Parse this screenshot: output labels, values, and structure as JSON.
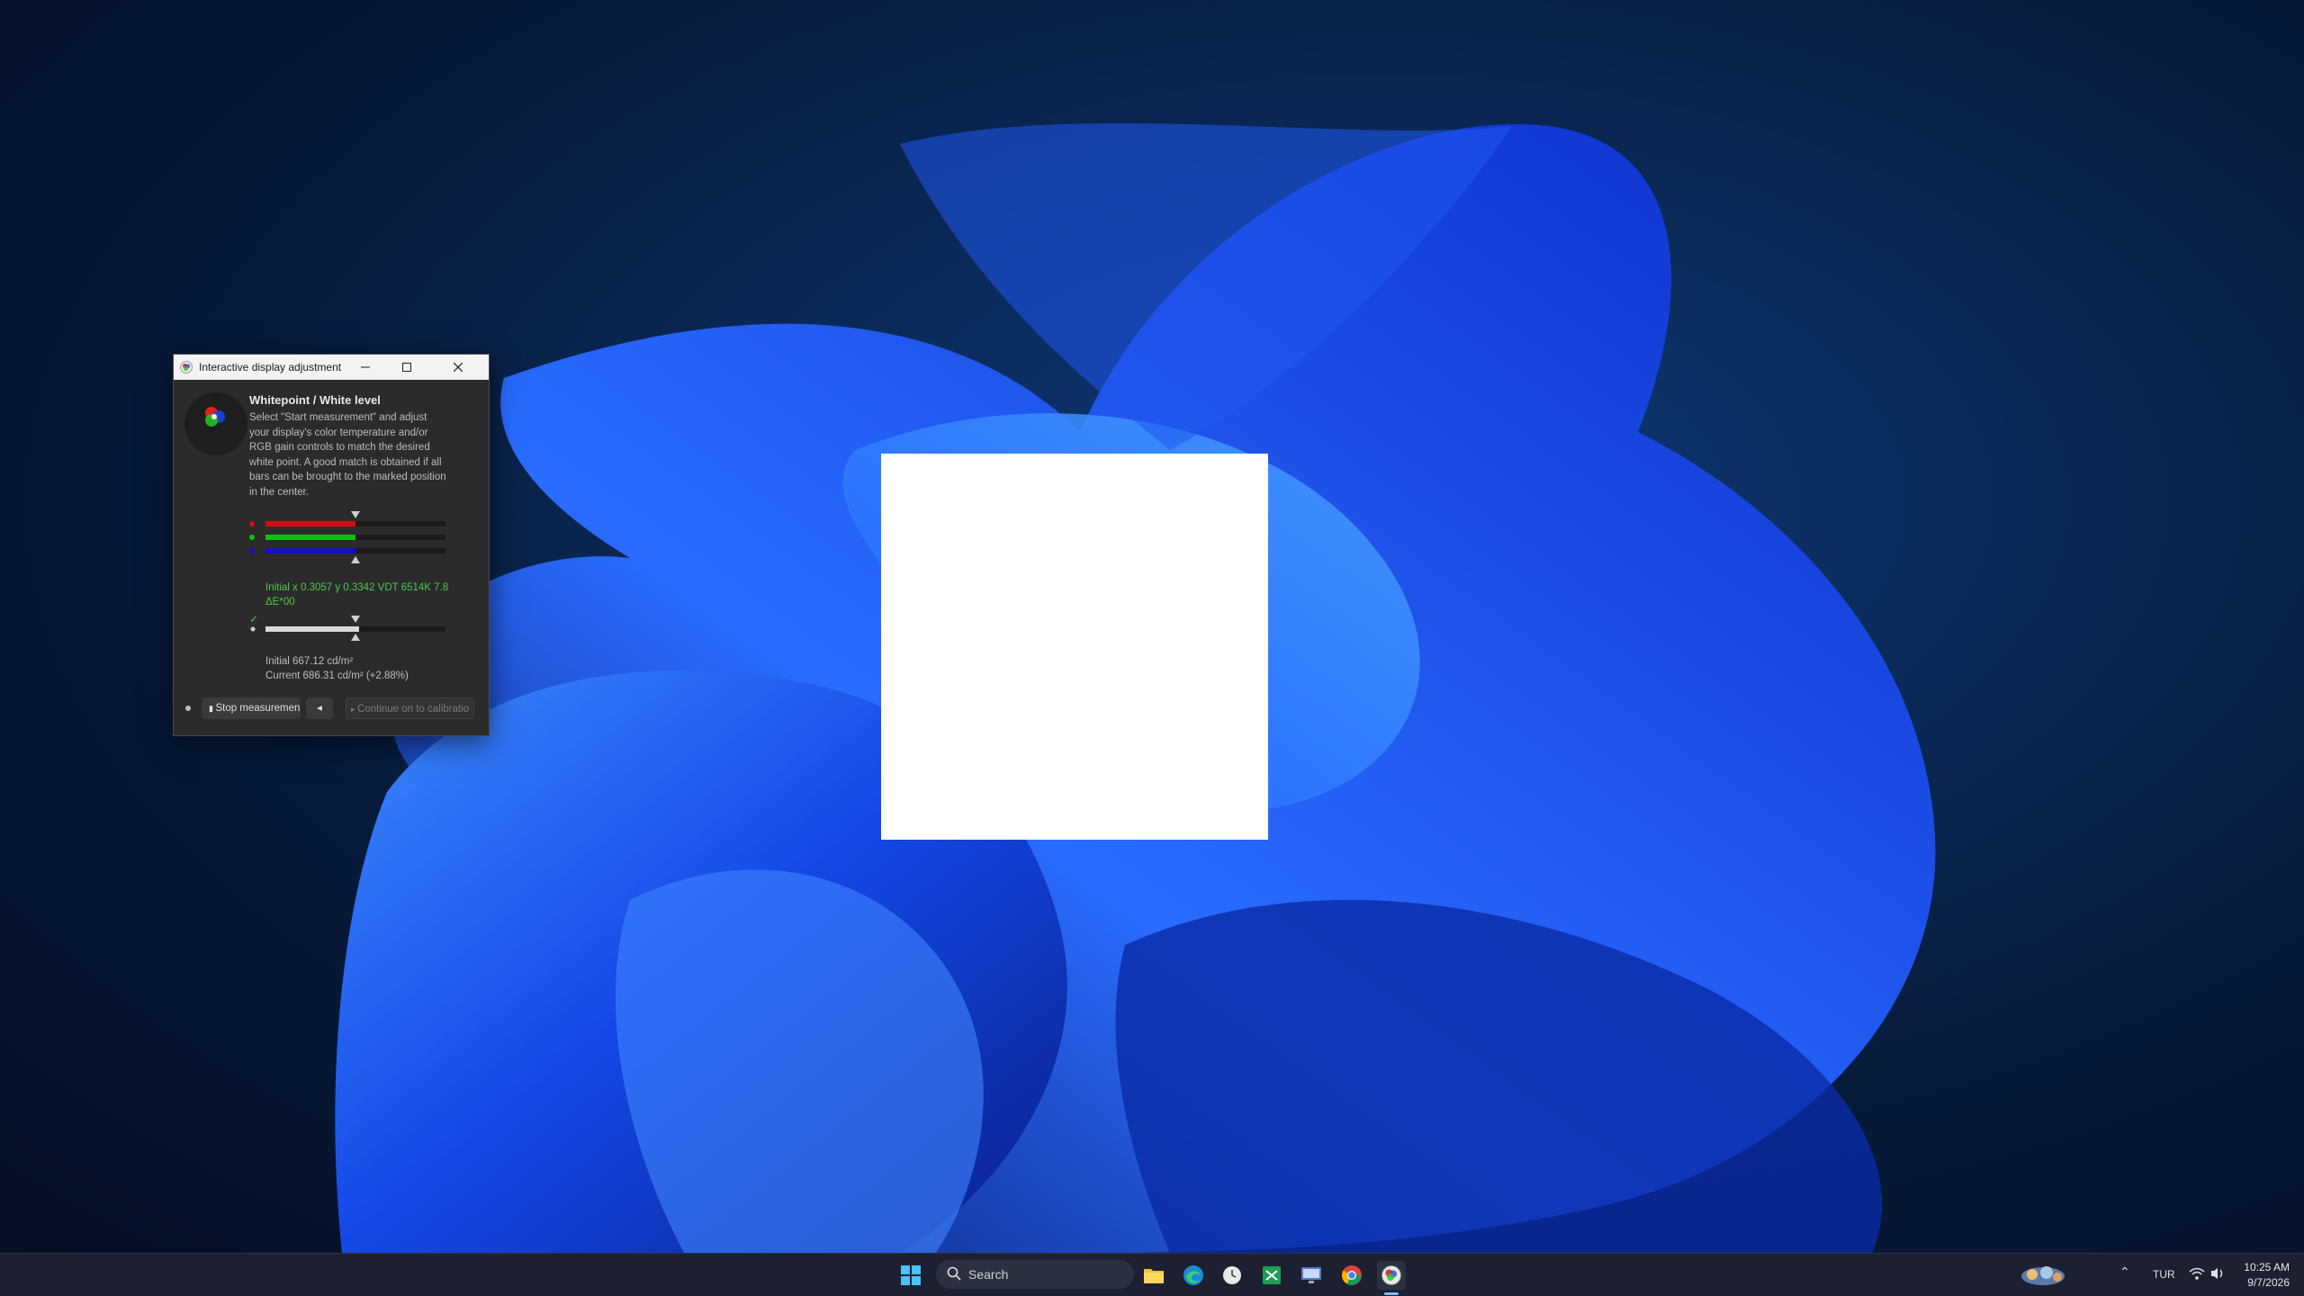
{
  "window": {
    "title": "Interactive display adjustment",
    "heading": "Whitepoint / White level",
    "instructions": "Select \"Start measurement\" and adjust your display's color temperature and/or RGB gain controls to match the desired white point. A good match is obtained if all bars can be brought to the marked position in the center.",
    "rgb_levels": {
      "red": 0.5,
      "green": 0.5,
      "blue": 0.5
    },
    "luminance_level": 0.52,
    "status_line1": "Initial x 0.3057 y 0.3342 VDT 6514K 7.8",
    "status_line2": "ΔE*00",
    "luminance_initial": "Initial 667.12 cd/m²",
    "luminance_current": "Current 686.31 cd/m² (+2.88%)",
    "stop_button": "Stop measuremen",
    "continue_button": "Continue on to calibratio"
  },
  "taskbar": {
    "search_label": "Search",
    "language": "TUR",
    "time": "10:25 AM",
    "date": "9/7/2026"
  },
  "colors": {
    "red": "#d01010",
    "green": "#10c010",
    "blue": "#1010d0",
    "status_green": "#4cc84c",
    "window_bg": "#2b2b2b"
  }
}
